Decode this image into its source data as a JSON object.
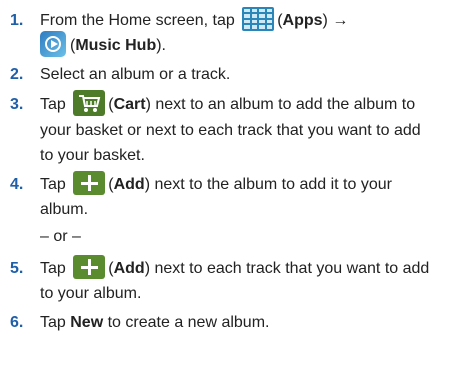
{
  "steps": [
    {
      "num": "1.",
      "lines": [
        {
          "pre": "From the Home screen, tap",
          "icon": "apps-grid-icon",
          "paren_open": "(",
          "bold": "Apps",
          "paren_close": ")",
          "post": "→"
        },
        {
          "icon": "music-hub-icon",
          "paren_open": "(",
          "bold": "Music Hub",
          "paren_close": ")."
        }
      ]
    },
    {
      "num": "2.",
      "lines": [
        {
          "pre": "Select an album or a track."
        }
      ]
    },
    {
      "num": "3.",
      "lines": [
        {
          "pre": "Tap",
          "icon": "cart-icon",
          "paren_open": "(",
          "bold": "Cart",
          "paren_close": ")",
          "post": "next to an album to add the album to"
        },
        {
          "pre": "your basket or next to each track that you want to add"
        },
        {
          "pre": "to your basket."
        }
      ]
    },
    {
      "num": "4.",
      "lines": [
        {
          "pre": "Tap",
          "icon": "add-icon",
          "paren_open": "(",
          "bold": "Add",
          "paren_close": ")",
          "post": "next to the album to add it to your"
        },
        {
          "pre": "album."
        }
      ]
    },
    {
      "num": "",
      "lines": [
        {
          "pre": "– or –"
        }
      ]
    },
    {
      "num": "5.",
      "lines": [
        {
          "pre": "Tap",
          "icon": "add-icon",
          "paren_open": "(",
          "bold": "Add",
          "paren_close": ")",
          "post": "next to each track that you want to add"
        },
        {
          "pre": "to your album."
        }
      ]
    },
    {
      "num": "6.",
      "lines": [
        {
          "pre": "Tap",
          "bold_inline": "New",
          "post": "to create a new album."
        }
      ]
    }
  ],
  "colors": {
    "number": "#1f5fa8",
    "apps_icon": "#2a86b8",
    "cart_icon": "#4d7b2a",
    "add_icon": "#5a8b2e"
  }
}
